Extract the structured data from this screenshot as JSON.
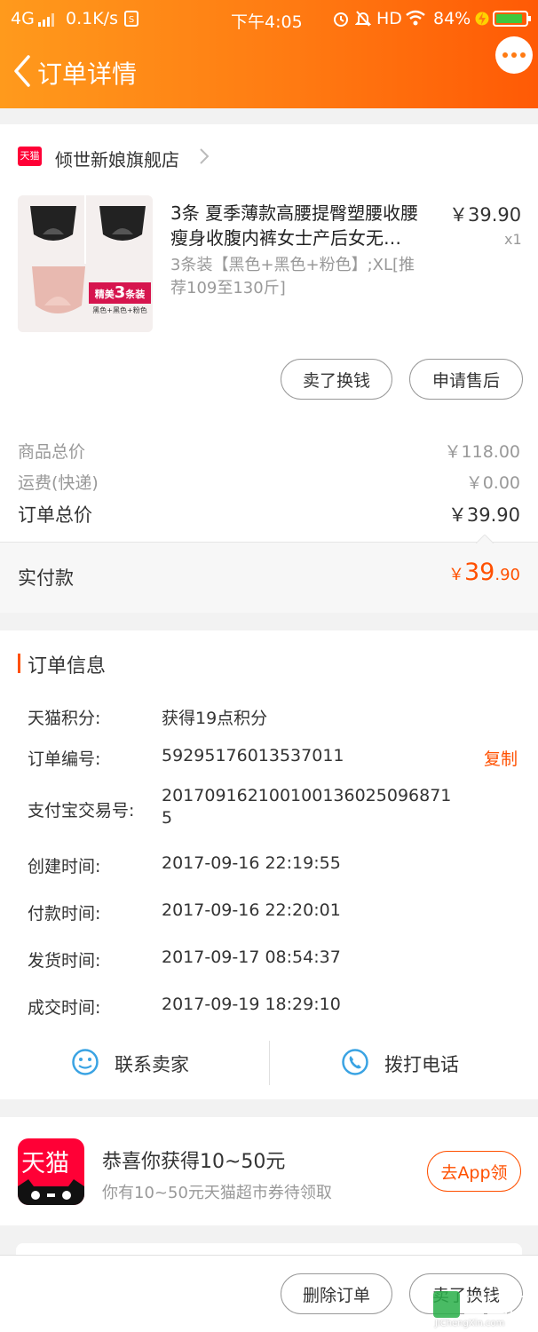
{
  "status": {
    "network": "4G",
    "speed": "0.1K/s",
    "time": "下午4:05",
    "hd": "HD",
    "battery": "84%"
  },
  "nav": {
    "title": "订单详情"
  },
  "shop": {
    "badge": "天猫",
    "name": "倾世新娘旗舰店"
  },
  "product": {
    "title": "3条 夏季薄款高腰提臀塑腰收腰瘦身收腹内裤女士产后女无…",
    "title_line1": "3条 夏季薄款高腰提臀塑腰收腰",
    "title_line2": "瘦身收腹内裤女士产后女无…",
    "price": "￥39.90",
    "qty": "x1",
    "sku_line1": "3条装【黑色+黑色+粉色】;XL[推",
    "sku_line2": "荐109至130斤]",
    "image_tag": "精美3条装",
    "image_tag_prefix": "精美",
    "image_tag_num": "3",
    "image_tag_suffix": "条装",
    "image_caption": "黑色+黑色+粉色"
  },
  "item_actions": {
    "sell": "卖了换钱",
    "after_sale": "申请售后"
  },
  "summary": {
    "goods_label": "商品总价",
    "goods_value": "￥118.00",
    "shipping_label": "运费(快递)",
    "shipping_value": "￥0.00",
    "total_label": "订单总价",
    "total_value": "￥39.90",
    "paid_label": "实付款",
    "paid_yen": "￥",
    "paid_int": "39",
    "paid_dec": ".90"
  },
  "order_info": {
    "title": "订单信息",
    "rows": [
      {
        "label": "天猫积分:",
        "value": "获得19点积分"
      },
      {
        "label": "订单编号:",
        "value": "59295176013537011",
        "action": "复制"
      },
      {
        "label": "支付宝交易号:",
        "value_line1": "20170916210010013602509687​1",
        "value_line2": "5"
      },
      {
        "label": "创建时间:",
        "value": "2017-09-16 22:19:55"
      },
      {
        "label": "付款时间:",
        "value": "2017-09-16 22:20:01"
      },
      {
        "label": "发货时间:",
        "value": "2017-09-17 08:54:37"
      },
      {
        "label": "成交时间:",
        "value": "2017-09-19 18:29:10"
      }
    ],
    "contact_seller": "联系卖家",
    "call_phone": "拨打电话"
  },
  "promo": {
    "logo_text": "天猫",
    "title": "恭喜你获得10~50元",
    "subtitle": "你有10~50元天猫超市券待领取",
    "button": "去App领"
  },
  "bottom": {
    "delete": "删除订单",
    "sell": "卖了换钱"
  },
  "watermark": {
    "domain": "JiChengXin.com"
  },
  "colors": {
    "orange": "#ff7a12",
    "accent_price": "#ff5000",
    "tmall_red": "#ff0036",
    "blue_icon": "#3aa3e3"
  }
}
